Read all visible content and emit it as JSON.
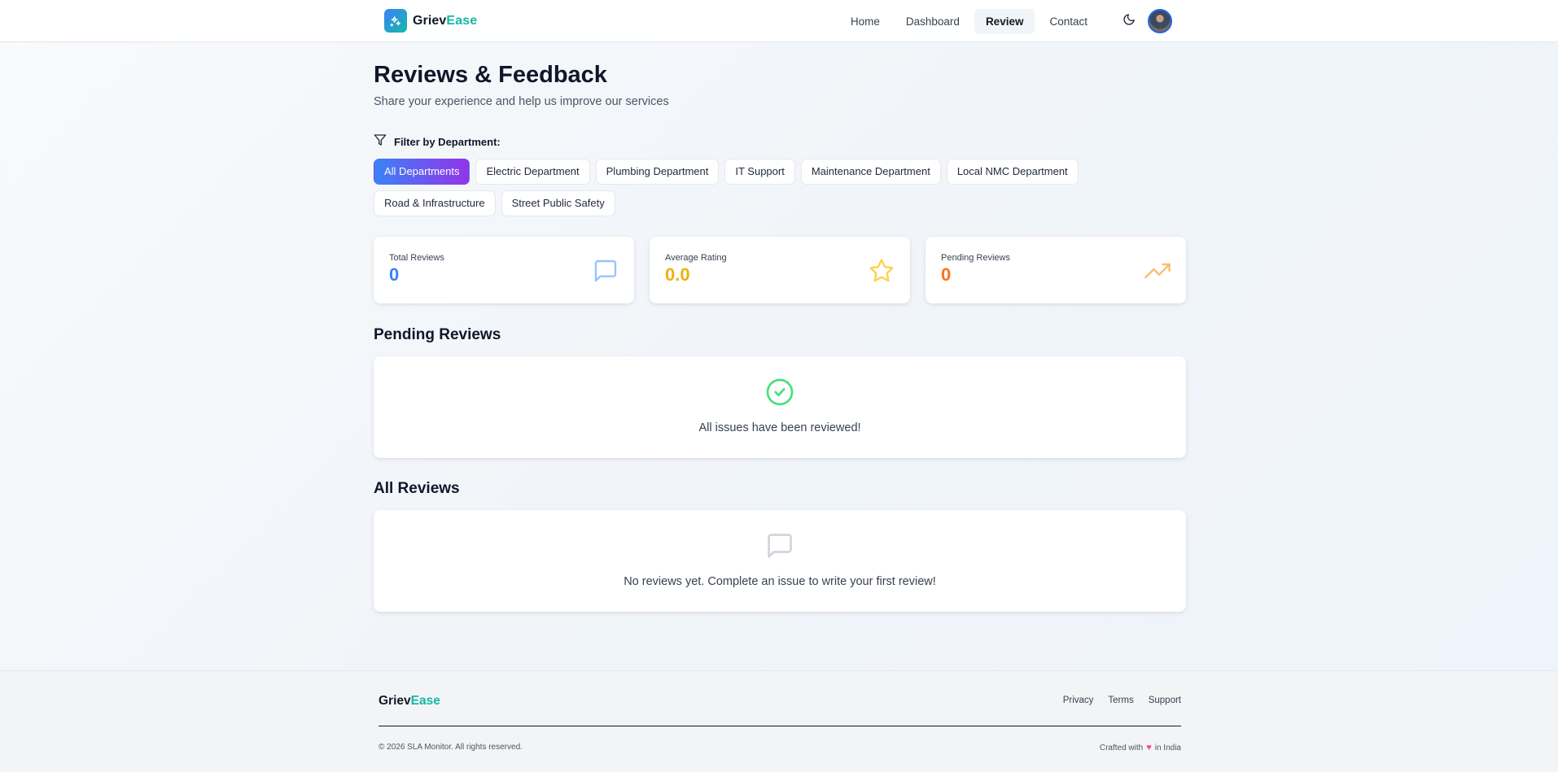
{
  "brand": {
    "name_part1": "Griev",
    "name_part2": "Ease"
  },
  "nav": {
    "links": [
      {
        "label": "Home"
      },
      {
        "label": "Dashboard"
      },
      {
        "label": "Review",
        "active": true
      },
      {
        "label": "Contact"
      }
    ],
    "theme_icon": "moon-icon",
    "avatar_icon": "user-avatar"
  },
  "page": {
    "title": "Reviews & Feedback",
    "subtitle": "Share your experience and help us improve our services"
  },
  "filter": {
    "label": "Filter by Department:",
    "icon": "filter-icon",
    "departments": [
      "All Departments",
      "Electric Department",
      "Plumbing Department",
      "IT Support",
      "Maintenance Department",
      "Local NMC Department",
      "Road & Infrastructure",
      "Street Public Safety"
    ],
    "selected": "All Departments"
  },
  "stats": [
    {
      "label": "Total Reviews",
      "value": "0",
      "color": "#3b82f6",
      "icon": "message-square-icon"
    },
    {
      "label": "Average Rating",
      "value": "0.0",
      "color": "#eab308",
      "icon": "star-icon"
    },
    {
      "label": "Pending Reviews",
      "value": "0",
      "color": "#f97316",
      "icon": "trending-up-icon"
    }
  ],
  "pending_section": {
    "title": "Pending Reviews",
    "empty_message": "All issues have been reviewed!",
    "empty_icon": "check-circle-icon"
  },
  "all_section": {
    "title": "All Reviews",
    "empty_message": "No reviews yet. Complete an issue to write your first review!",
    "empty_icon": "message-square-icon"
  },
  "footer": {
    "brand_part1": "Griev",
    "brand_part2": "Ease",
    "links": [
      "Privacy",
      "Terms",
      "Support"
    ],
    "copyright": "© 2026 SLA Monitor. All rights reserved.",
    "crafted_prefix": "Crafted with",
    "crafted_suffix": "in India"
  },
  "colors": {
    "accent_teal": "#14b8a6",
    "accent_blue": "#3b82f6",
    "accent_purple": "#9333ea",
    "success_green": "#4ade80",
    "heart_pink": "#ec4899"
  }
}
